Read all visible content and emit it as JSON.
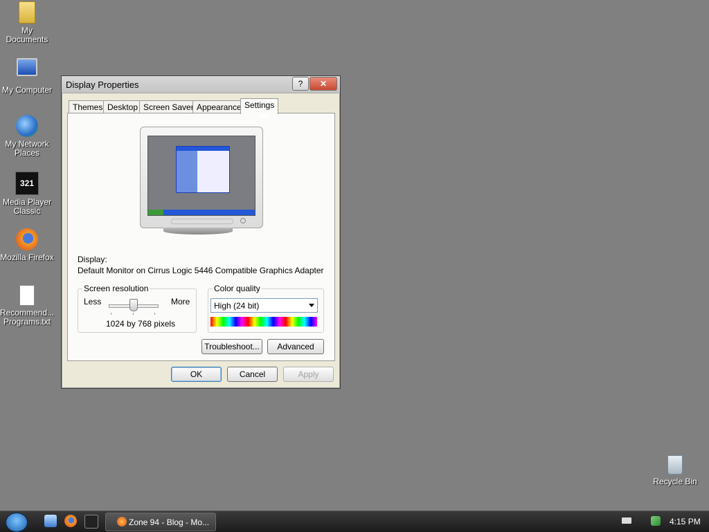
{
  "desktop": {
    "icons": [
      {
        "label": "My Documents"
      },
      {
        "label": "My Computer"
      },
      {
        "label": "My Network Places"
      },
      {
        "label": "Media Player Classic"
      },
      {
        "label": "Mozilla Firefox"
      },
      {
        "label": "Recommend... Programs.txt"
      },
      {
        "label": "Recycle Bin"
      }
    ]
  },
  "window": {
    "title": "Display Properties",
    "help_label": "?",
    "close_label": "✕",
    "tabs": [
      {
        "label": "Themes"
      },
      {
        "label": "Desktop"
      },
      {
        "label": "Screen Saver"
      },
      {
        "label": "Appearance"
      },
      {
        "label": "Settings"
      }
    ],
    "active_tab": "Settings",
    "display_label": "Display:",
    "display_value": "Default Monitor on Cirrus Logic 5446 Compatible Graphics Adapter",
    "resolution": {
      "group_label": "Screen resolution",
      "less_label": "Less",
      "more_label": "More",
      "value_text": "1024 by 768 pixels"
    },
    "color": {
      "group_label": "Color quality",
      "selected": "High (24 bit)"
    },
    "buttons": {
      "troubleshoot": "Troubleshoot...",
      "advanced": "Advanced",
      "ok": "OK",
      "cancel": "Cancel",
      "apply": "Apply"
    }
  },
  "taskbar": {
    "task_title": "Zone 94 - Blog - Mo...",
    "clock": "4:15 PM"
  }
}
